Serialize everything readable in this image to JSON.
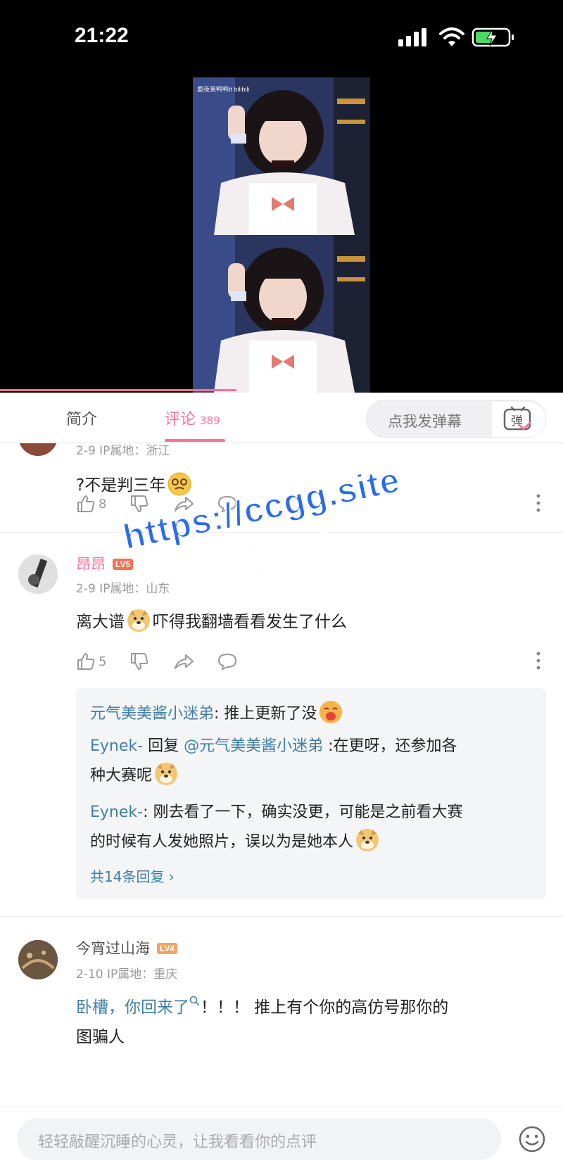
{
  "status_bar": {
    "time": "21:22"
  },
  "video": {
    "watermark": "鹿夜美鸭鸭tt bilibili"
  },
  "tabs": {
    "intro": "简介",
    "comments": "评论",
    "comments_count": "389",
    "danmaku_placeholder": "点我发弹幕",
    "danmaku_icon": "弹"
  },
  "comments": [
    {
      "meta": "2-9  IP属地：浙江",
      "text": "?不是判三年",
      "likes": "8"
    },
    {
      "username": "昂昂",
      "level": "LV5",
      "meta": "2-9  IP属地：山东",
      "text_before": "离大谱",
      "text_after": "吓得我翻墙看看发生了什么",
      "likes": "5",
      "replies": [
        {
          "user": "元气美美酱小迷弟",
          "text": ": 推上更新了没"
        },
        {
          "user": "Eynek-",
          "reply_word": " 回复 ",
          "mention": "@元气美美酱小迷弟",
          "text": " :在更呀，还参加各",
          "text2": "种大赛呢"
        },
        {
          "user": "Eynek-",
          "text": ": 刚去看了一下，确实没更，可能是之前看大赛",
          "text2": "的时候有人发她照片，误以为是她本人"
        }
      ],
      "more_replies": "共14条回复 ›"
    },
    {
      "username": "今宵过山海",
      "level": "LV4",
      "meta": "2-10  IP属地：重庆",
      "text_blue": "卧槽，你回来了",
      "text_rest": "！！！ 推上有个你的高仿号那你的",
      "text2": "图骗人"
    }
  ],
  "input": {
    "placeholder": "轻轻敲醒沉睡的心灵，让我看看你的点评"
  },
  "overlay": {
    "line1": "https://ccgg.site",
    "line2": "看完整版"
  },
  "colors": {
    "accent": "#fb7299",
    "link": "#3f7ea6",
    "watermark": "#2b6bea"
  }
}
